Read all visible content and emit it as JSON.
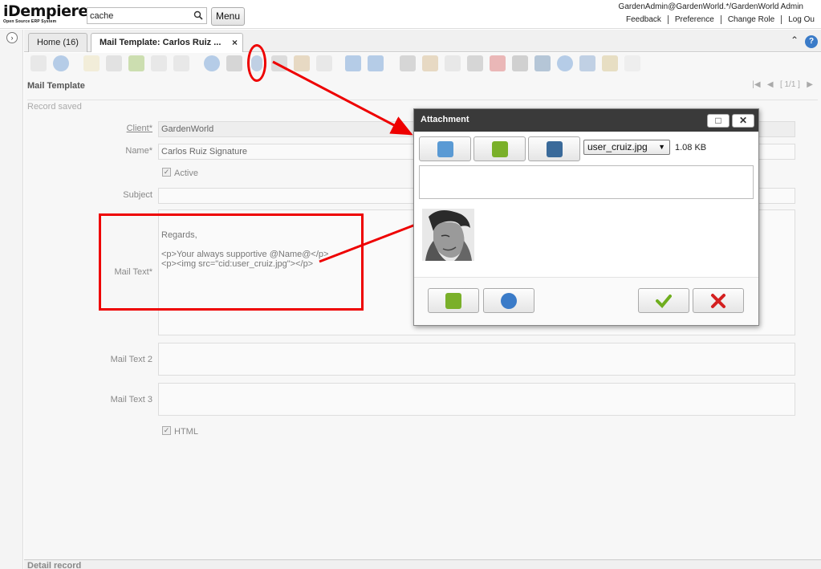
{
  "header": {
    "logo_main": "iDempiere",
    "logo_sub": "Open Source ERP System",
    "search_value": "cache",
    "menu_label": "Menu",
    "user_info": "GardenAdmin@GardenWorld.*/GardenWorld Admin",
    "links": [
      "Feedback",
      "Preference",
      "Change Role",
      "Log Ou"
    ]
  },
  "tabs": [
    {
      "label": "Home (16)"
    },
    {
      "label": "Mail Template: Carlos Ruiz ...",
      "close": "×"
    }
  ],
  "window": {
    "title": "Mail Template",
    "pager": "[ 1/1 ]",
    "status": "Record saved",
    "detail_label": "Detail record"
  },
  "form": {
    "client_label": "Client*",
    "client_value": "GardenWorld",
    "name_label": "Name*",
    "name_value": "Carlos Ruiz Signature",
    "active_label": "Active",
    "subject_label": "Subject",
    "subject_value": "",
    "mailtext_label": "Mail Text*",
    "mailtext_line1": "Regards,",
    "mailtext_line2": "<p>Your always supportive @Name@</p>",
    "mailtext_line3": "<p><img src=\"cid:user_cruiz.jpg\"></p>",
    "mailtext2_label": "Mail Text 2",
    "mailtext3_label": "Mail Text 3",
    "html_label": "HTML"
  },
  "dialog": {
    "title": "Attachment",
    "selected_file": "user_cruiz.jpg",
    "file_size": "1.08 KB"
  },
  "colors": {
    "annotation": "#e00000",
    "dialog_title": "#3a3a3a",
    "green_check": "#6fae1e",
    "red_cross": "#d42020"
  }
}
